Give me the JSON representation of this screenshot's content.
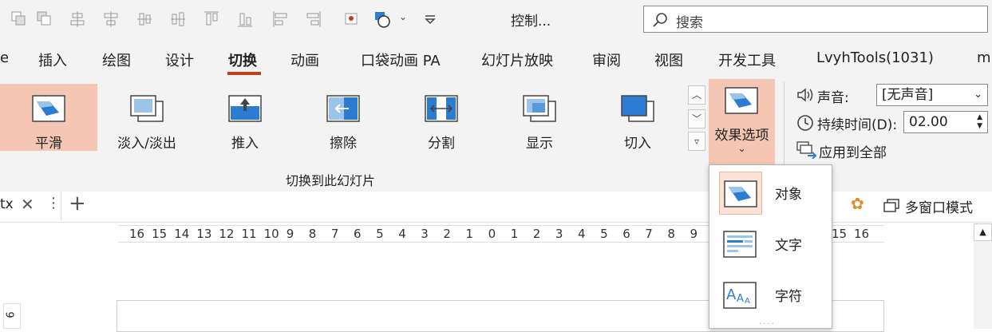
{
  "window": {
    "title": "控制..."
  },
  "search": {
    "placeholder": "搜索"
  },
  "qat_icons": [
    "align-icon",
    "arrange-icon",
    "distribute-h-icon",
    "distribute-v-icon",
    "center-h-icon",
    "center-v-icon",
    "align-top-icon",
    "align-bottom-icon",
    "align-left-icon",
    "align-right-icon",
    "picture-icon",
    "shape-fill-icon",
    "customize-qat-icon"
  ],
  "tabs": [
    {
      "label": "e",
      "active": false
    },
    {
      "label": "插入",
      "active": false
    },
    {
      "label": "绘图",
      "active": false
    },
    {
      "label": "设计",
      "active": false
    },
    {
      "label": "切换",
      "active": true
    },
    {
      "label": "动画",
      "active": false
    },
    {
      "label": "口袋动画 PA",
      "active": false
    },
    {
      "label": "幻灯片放映",
      "active": false
    },
    {
      "label": "审阅",
      "active": false
    },
    {
      "label": "视图",
      "active": false
    },
    {
      "label": "开发工具",
      "active": false
    },
    {
      "label": "LvyhTools(1031)",
      "active": false
    },
    {
      "label": "m",
      "active": false
    }
  ],
  "transitions": {
    "items": [
      {
        "label": "平滑",
        "icon": "morph-icon",
        "selected": true
      },
      {
        "label": "淡入/淡出",
        "icon": "fade-icon",
        "selected": false
      },
      {
        "label": "推入",
        "icon": "push-icon",
        "selected": false
      },
      {
        "label": "擦除",
        "icon": "wipe-icon",
        "selected": false
      },
      {
        "label": "分割",
        "icon": "split-icon",
        "selected": false
      },
      {
        "label": "显示",
        "icon": "reveal-icon",
        "selected": false
      },
      {
        "label": "切入",
        "icon": "cut-icon",
        "selected": false
      }
    ],
    "group_label": "切换到此幻灯片",
    "effect_options_label": "效果选项"
  },
  "timing": {
    "sound_label": "声音:",
    "sound_value": "[无声音]",
    "duration_label": "持续时间(D):",
    "duration_value": "02.00",
    "apply_all_label": "应用到全部"
  },
  "doc_tabs": {
    "tab_name": "tx",
    "multi_window_label": "多窗口模式"
  },
  "ruler": {
    "ticks": [
      "16",
      "15",
      "14",
      "13",
      "12",
      "11",
      "10",
      "9",
      "8",
      "7",
      "6",
      "5",
      "4",
      "3",
      "2",
      "1",
      "0",
      "1",
      "2",
      "3",
      "4",
      "5",
      "6",
      "7",
      "8",
      "9"
    ],
    "right_ticks": [
      "15",
      "16"
    ]
  },
  "vertical_ruler": {
    "label": "9"
  },
  "effect_dropdown": {
    "items": [
      {
        "label": "对象",
        "selected": true
      },
      {
        "label": "文字",
        "selected": false
      },
      {
        "label": "字符",
        "selected": false
      }
    ]
  },
  "colors": {
    "accent": "#c43e1c",
    "selected_bg": "#f4c6b3",
    "icon_blue": "#2b7cd3"
  }
}
